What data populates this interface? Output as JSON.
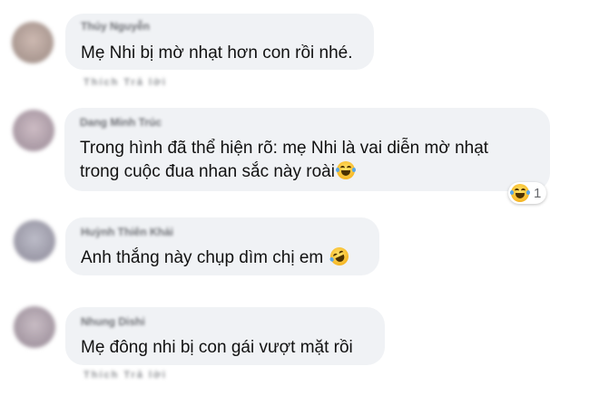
{
  "comments": [
    {
      "author": "Thúy Nguyễn",
      "lines": [
        "Mẹ Nhi bị mờ nhạt hơn con rồi nhé."
      ],
      "actions": "Thích   Trả lời",
      "avatar_color": "#b9a9a3"
    },
    {
      "author": "Dang Minh Trúc",
      "lines": [
        "Trong hình đã thể hiện rõ: mẹ Nhi là vai diễn mờ nhạt",
        "trong cuộc đua nhan sắc này roài"
      ],
      "trailing_emoji": "grinning-squinting-tears-emoji",
      "reaction": {
        "emoji": "laughing-reaction-emoji",
        "count": "1"
      },
      "avatar_color": "#b7a8b0"
    },
    {
      "author": "Huỳnh Thiên Khải",
      "lines": [
        "Anh thắng này chụp dìm chị em"
      ],
      "trailing_emoji": "rolling-on-floor-laughing-emoji",
      "avatar_color": "#a7a6b2"
    },
    {
      "author": "Nhung Dishi",
      "lines": [
        "Mẹ đông nhi bị con gái vượt mặt rồi"
      ],
      "actions": "Thích   Trả lời",
      "avatar_color": "#b4a9b2"
    }
  ]
}
